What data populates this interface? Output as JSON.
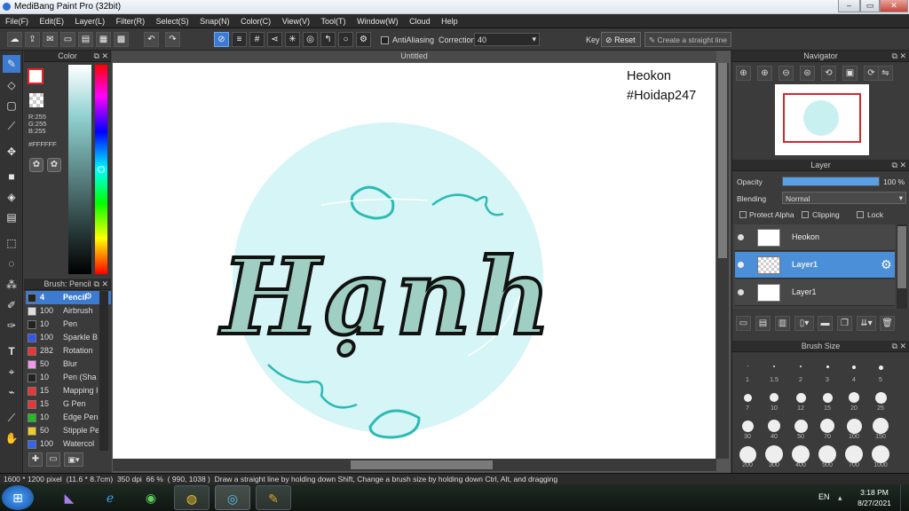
{
  "window": {
    "title": "MediBang Paint Pro (32bit)",
    "controls": [
      "–",
      "▭",
      "✕"
    ]
  },
  "menu": [
    "File(F)",
    "Edit(E)",
    "Layer(L)",
    "Filter(R)",
    "Select(S)",
    "Snap(N)",
    "Color(C)",
    "View(V)",
    "Tool(T)",
    "Window(W)",
    "Cloud",
    "Help"
  ],
  "toolbar": {
    "antialiasing_label": "AntiAliasing",
    "correction_label": "Correction",
    "correction_value": "40",
    "key_label": "Key",
    "reset_label": "Reset",
    "straight_line_label": "Create a straight line"
  },
  "color_panel": {
    "title": "Color",
    "r": "R:255",
    "g": "G:255",
    "b": "B:255",
    "hex": "#FFFFFF"
  },
  "brush_panel": {
    "title": "Brush: Pencil",
    "items": [
      {
        "size": "4",
        "name": "Pencil",
        "color": "#222222"
      },
      {
        "size": "100",
        "name": "Airbrush",
        "color": "#dddddd"
      },
      {
        "size": "10",
        "name": "Pen",
        "color": "#222222"
      },
      {
        "size": "100",
        "name": "Sparkle B",
        "color": "#3355ee"
      },
      {
        "size": "282",
        "name": "Rotation",
        "color": "#ee3333"
      },
      {
        "size": "50",
        "name": "Blur",
        "color": "#ee99ee"
      },
      {
        "size": "10",
        "name": "Pen (Sha",
        "color": "#222222"
      },
      {
        "size": "15",
        "name": "Mapping I",
        "color": "#ee3333"
      },
      {
        "size": "15",
        "name": "G Pen",
        "color": "#ee3333"
      },
      {
        "size": "10",
        "name": "Edge Pen",
        "color": "#22bb22"
      },
      {
        "size": "50",
        "name": "Stipple Pe",
        "color": "#eecc22"
      },
      {
        "size": "100",
        "name": "Watercol",
        "color": "#3366ee"
      }
    ]
  },
  "canvas": {
    "tab_title": "Untitled",
    "watermark_line1": "Heokon",
    "watermark_line2": "#Hoidap247",
    "artwork_text": "Hạnh",
    "circle_color": "#d6f5f6",
    "accent_color": "#2bbab4"
  },
  "navigator": {
    "title": "Navigator"
  },
  "layer_panel": {
    "title": "Layer",
    "opacity_label": "Opacity",
    "opacity_value": "100 %",
    "opacity_fraction": 1.0,
    "blending_label": "Blending",
    "blending_value": "Normal",
    "protect_alpha": "Protect Alpha",
    "clipping": "Clipping",
    "lock": "Lock",
    "layers": [
      {
        "name": "Heokon",
        "selected": false
      },
      {
        "name": "Layer1",
        "selected": true
      },
      {
        "name": "Layer1",
        "selected": false
      }
    ]
  },
  "brush_size_panel": {
    "title": "Brush Size",
    "sizes": [
      "1",
      "1.5",
      "2",
      "3",
      "4",
      "5",
      "7",
      "10",
      "12",
      "15",
      "20",
      "25",
      "30",
      "40",
      "50",
      "70",
      "100",
      "150",
      "200",
      "300",
      "400",
      "500",
      "700",
      "1000"
    ]
  },
  "statusbar": {
    "dims": "1600 * 1200 pixel",
    "physical": "(11.6 * 8.7cm)",
    "dpi": "350 dpi",
    "zoom": "66 %",
    "coords": "( 990, 1038 )",
    "hint": "Draw a straight line by holding down Shift, Change a brush size by holding down Ctrl, Alt, and dragging"
  },
  "taskbar": {
    "language": "EN",
    "time": "3:18 PM",
    "date": "8/27/2021"
  }
}
